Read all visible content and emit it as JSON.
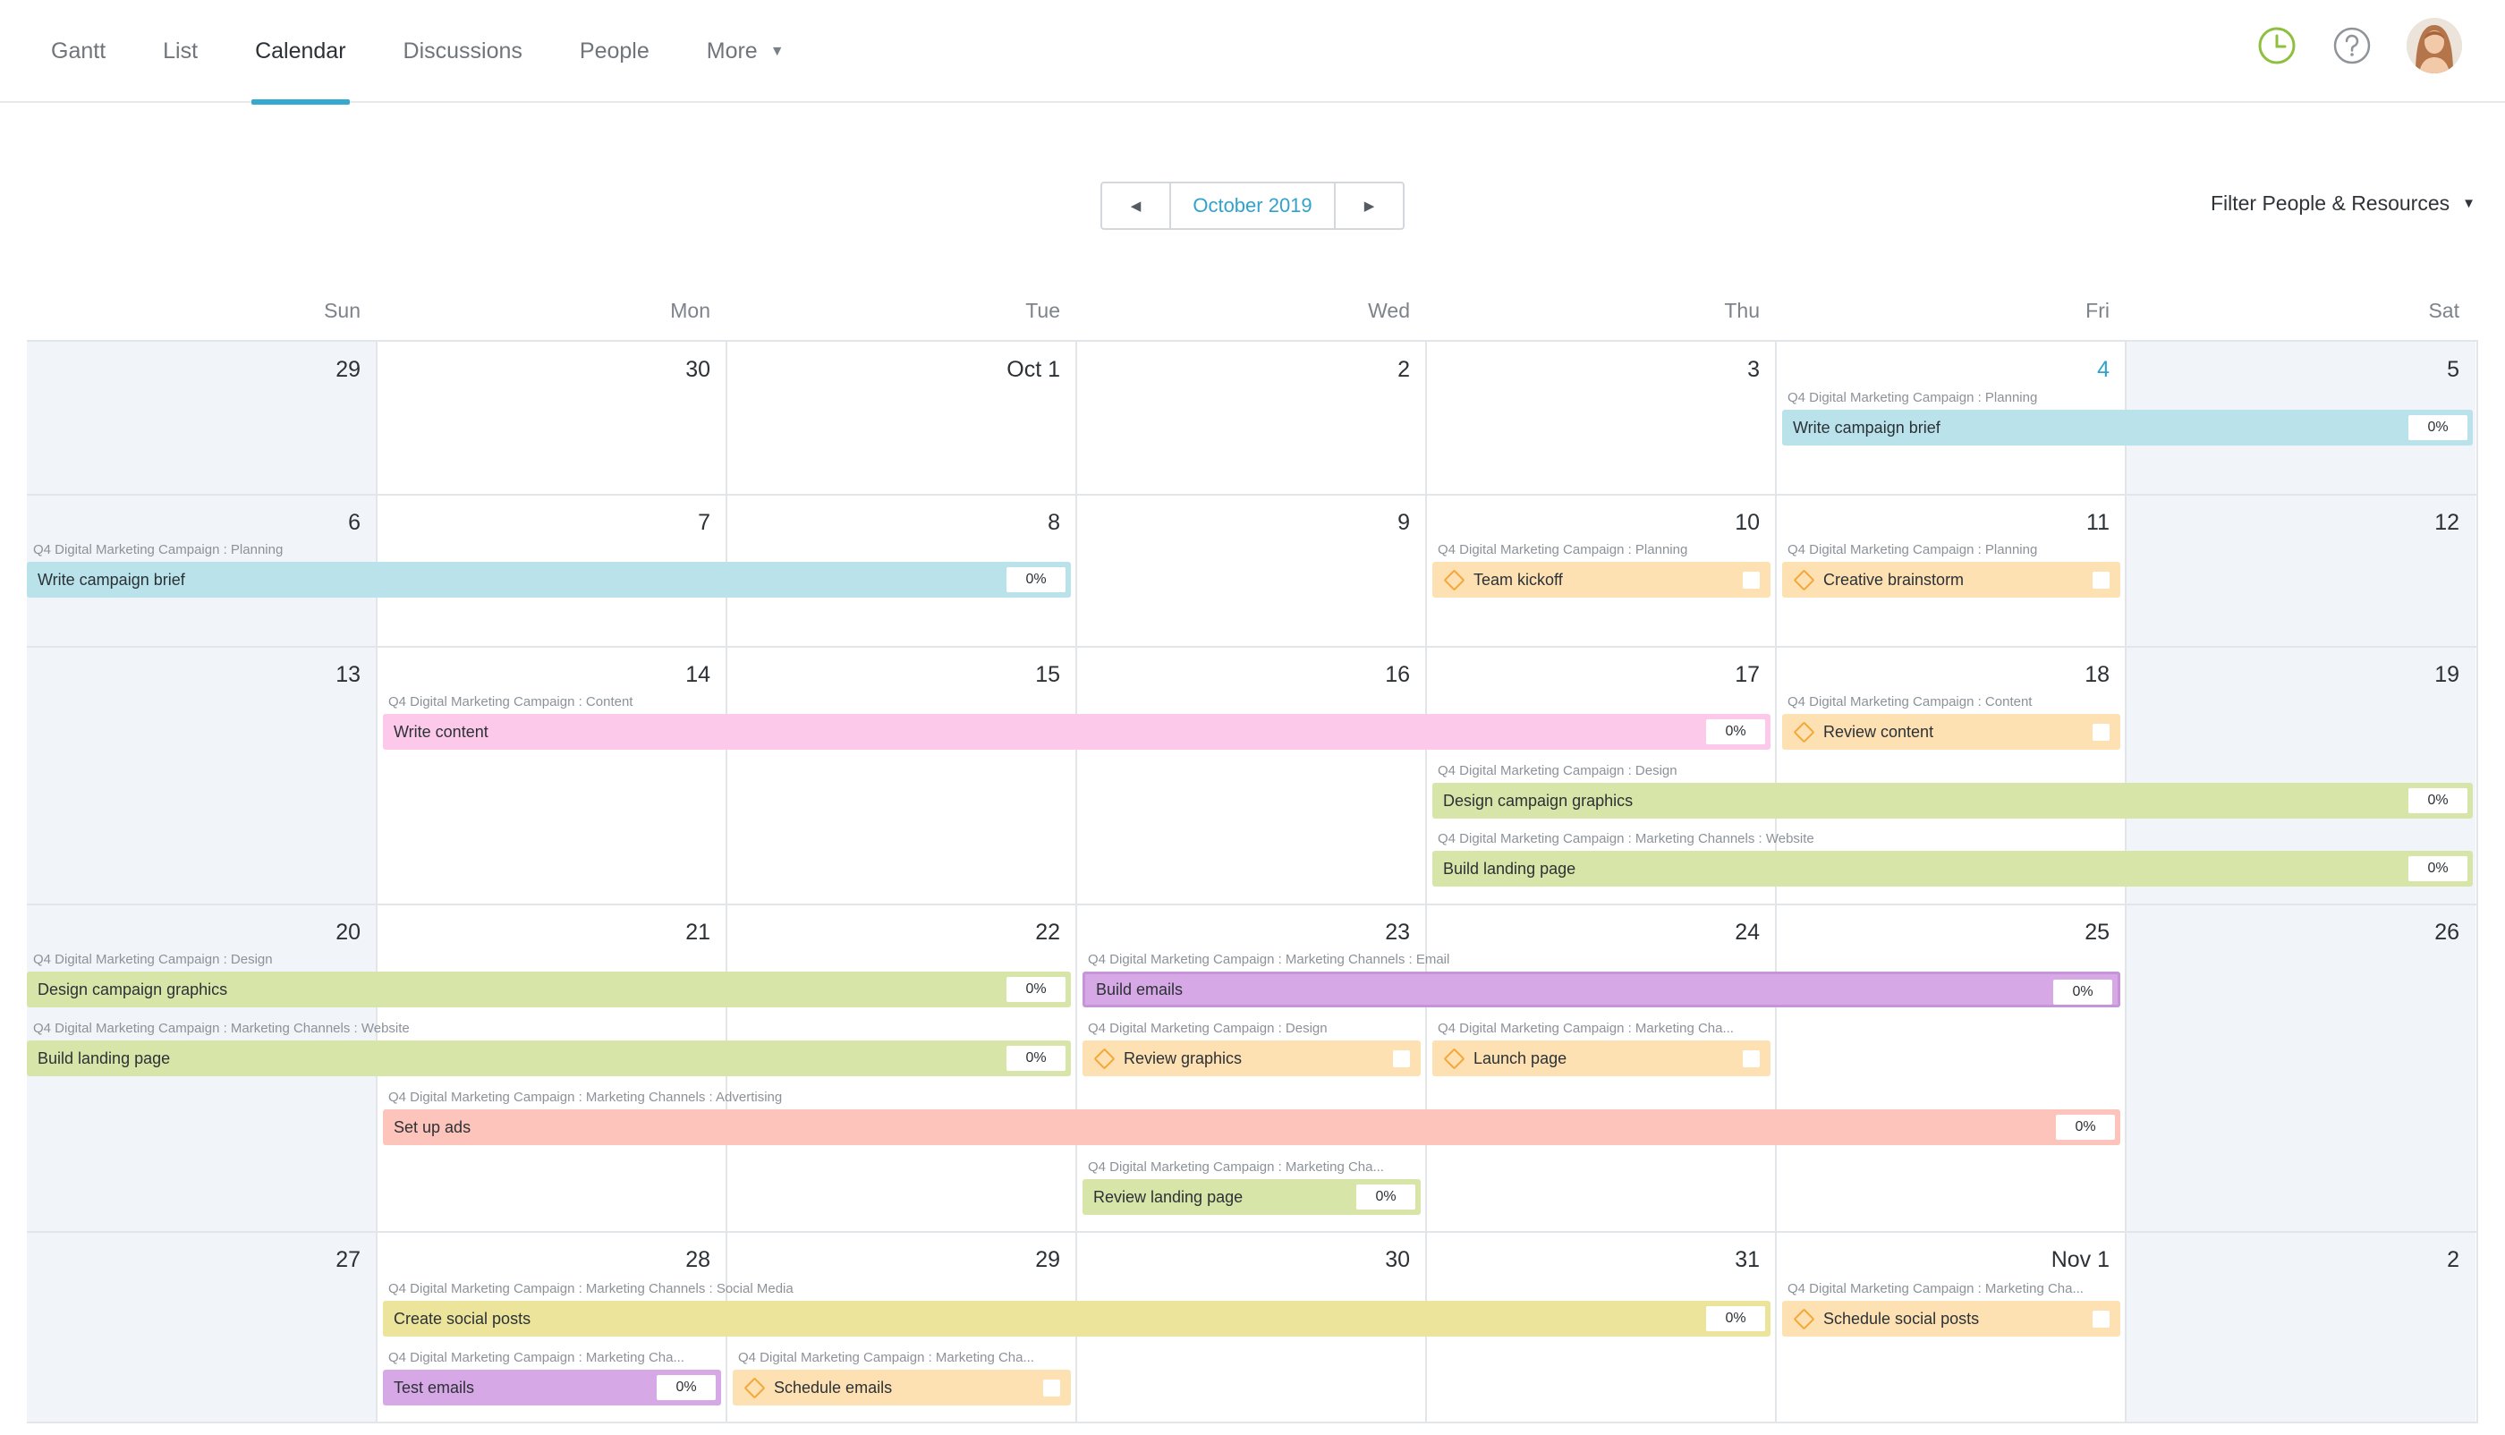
{
  "nav": {
    "tabs": [
      "Gantt",
      "List",
      "Calendar",
      "Discussions",
      "People"
    ],
    "more_label": "More",
    "active_tab": "Calendar"
  },
  "colors": {
    "accent": "#35a9d0",
    "timer_icon": "#8fbf3f",
    "blue_task": "#b9e2ea",
    "pink_task": "#fdc9ea",
    "green_task": "#d8e5a8",
    "purple_task": "#d6a8e5",
    "salmon_task": "#fdc4bb",
    "yellow_task": "#ebe49a",
    "milestone_task": "#fde1b3"
  },
  "icons": [
    "clock-icon",
    "help-icon",
    "avatar"
  ],
  "month_nav": {
    "prev": "◀",
    "label": "October 2019",
    "next": "▶"
  },
  "filter": {
    "label": "Filter People & Resources"
  },
  "weekdays": [
    "Sun",
    "Mon",
    "Tue",
    "Wed",
    "Thu",
    "Fri",
    "Sat"
  ],
  "weeks": [
    [
      "29",
      "30",
      "Oct 1",
      "2",
      "3",
      "4",
      "5"
    ],
    [
      "6",
      "7",
      "8",
      "9",
      "10",
      "11",
      "12"
    ],
    [
      "13",
      "14",
      "15",
      "16",
      "17",
      "18",
      "19"
    ],
    [
      "20",
      "21",
      "22",
      "23",
      "24",
      "25",
      "26"
    ],
    [
      "27",
      "28",
      "29",
      "30",
      "31",
      "Nov 1",
      "2"
    ]
  ],
  "today": "4",
  "tasks": [
    {
      "crumb": "Q4 Digital Marketing Campaign : Planning",
      "name": "Write campaign brief",
      "pct": "0%"
    },
    {
      "crumb": "Q4 Digital Marketing Campaign : Planning",
      "name": "Write campaign brief",
      "pct": "0%"
    },
    {
      "crumb": "Q4 Digital Marketing Campaign : Planning",
      "name": "Team kickoff"
    },
    {
      "crumb": "Q4 Digital Marketing Campaign : Planning",
      "name": "Creative brainstorm"
    },
    {
      "crumb": "Q4 Digital Marketing Campaign : Content",
      "name": "Write content",
      "pct": "0%"
    },
    {
      "crumb": "Q4 Digital Marketing Campaign : Content",
      "name": "Review content"
    },
    {
      "crumb": "Q4 Digital Marketing Campaign : Design",
      "name": "Design campaign graphics",
      "pct": "0%"
    },
    {
      "crumb": "Q4 Digital Marketing Campaign : Marketing Channels : Website",
      "name": "Build landing page",
      "pct": "0%"
    },
    {
      "crumb": "Q4 Digital Marketing Campaign : Design",
      "name": "Design campaign graphics",
      "pct": "0%"
    },
    {
      "crumb": "Q4 Digital Marketing Campaign : Marketing Channels : Email",
      "name": "Build emails",
      "pct": "0%"
    },
    {
      "crumb": "Q4 Digital Marketing Campaign : Marketing Channels : Website",
      "name": "Build landing page",
      "pct": "0%"
    },
    {
      "crumb": "Q4 Digital Marketing Campaign : Design",
      "name": "Review graphics"
    },
    {
      "crumb": "Q4 Digital Marketing Campaign : Marketing Cha...",
      "name": "Launch page"
    },
    {
      "crumb": "Q4 Digital Marketing Campaign : Marketing Channels : Advertising",
      "name": "Set up ads",
      "pct": "0%"
    },
    {
      "crumb": "Q4 Digital Marketing Campaign : Marketing Cha...",
      "name": "Review landing page",
      "pct": "0%"
    },
    {
      "crumb": "Q4 Digital Marketing Campaign : Marketing Channels : Social Media",
      "name": "Create social posts",
      "pct": "0%"
    },
    {
      "crumb": "Q4 Digital Marketing Campaign : Marketing Cha...",
      "name": "Schedule social posts"
    },
    {
      "crumb": "Q4 Digital Marketing Campaign : Marketing Cha...",
      "name": "Test emails",
      "pct": "0%"
    },
    {
      "crumb": "Q4 Digital Marketing Campaign : Marketing Cha...",
      "name": "Schedule emails"
    }
  ]
}
